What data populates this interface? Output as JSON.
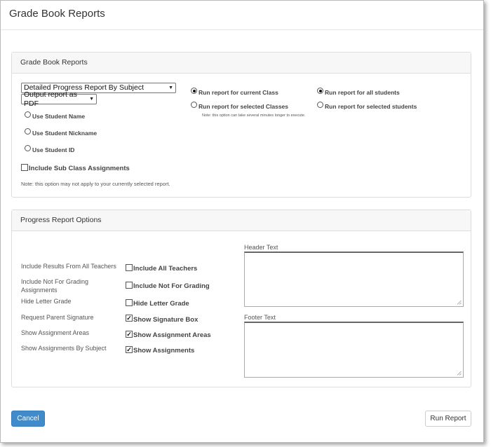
{
  "dialog": {
    "title": "Grade Book Reports"
  },
  "report_panel": {
    "heading": "Grade Book Reports",
    "report_select": "Detailed Progress Report By Subject",
    "output_select": "Output report as PDF",
    "name_options": [
      "Use Student Name",
      "Use Student Nickname",
      "Use Student ID"
    ],
    "include_sub_class": "Include Sub Class Assignments",
    "note": "Note: this option may not apply to your currently selected report.",
    "class_options": [
      "Run report for current Class",
      "Run report for selected Classes"
    ],
    "class_note": "Note: this option can take several minutes longer to execute.",
    "student_options": [
      "Run report for all students",
      "Run report for selected students"
    ]
  },
  "progress_panel": {
    "heading": "Progress Report Options",
    "rows": [
      {
        "label": "Include Results From All Teachers",
        "checkbox": "Include All Teachers",
        "checked": false
      },
      {
        "label": "Include Not For Grading Assignments",
        "checkbox": "Include Not For Grading",
        "checked": false
      },
      {
        "label": "Hide Letter Grade",
        "checkbox": "Hide Letter Grade",
        "checked": false
      },
      {
        "label": "Request Parent Signature",
        "checkbox": "Show Signature Box",
        "checked": true
      },
      {
        "label": "Show Assignment Areas",
        "checkbox": "Show Assignment Areas",
        "checked": true
      },
      {
        "label": "Show Assignments By Subject",
        "checkbox": "Show Assignments",
        "checked": true
      }
    ],
    "header_text_label": "Header Text",
    "footer_text_label": "Footer Text"
  },
  "buttons": {
    "cancel": "Cancel",
    "run": "Run Report"
  }
}
